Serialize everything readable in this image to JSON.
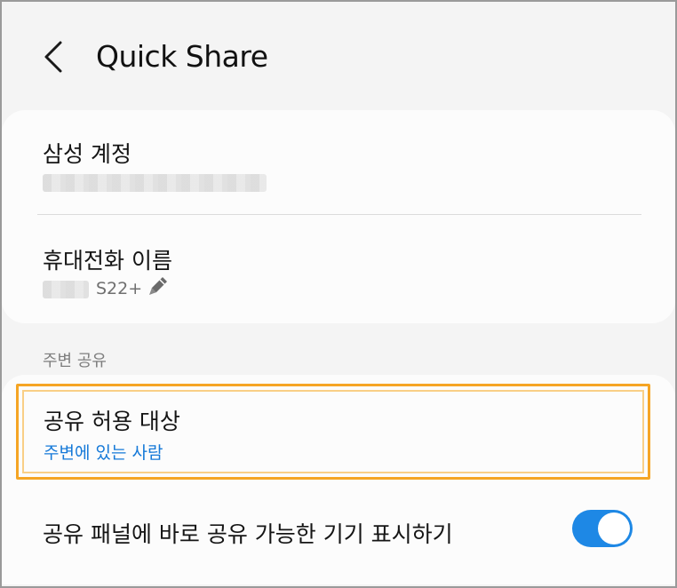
{
  "header": {
    "title": "Quick Share",
    "back_icon": "chevron-left-icon"
  },
  "account": {
    "label": "삼성 계정"
  },
  "device": {
    "label": "휴대전화 이름",
    "model": "S22+",
    "edit_icon": "pencil-icon"
  },
  "nearby": {
    "section_label": "주변 공유",
    "share_with_label": "공유 허용 대상",
    "share_with_value": "주변에 있는 사람",
    "show_devices_label": "공유 패널에 바로 공유 가능한 기기 표시하기",
    "show_devices_on": true
  },
  "colors": {
    "accent": "#1579d8",
    "toggle_on": "#1e88e5",
    "highlight_border": "#f5a524",
    "background": "#f4f4f4",
    "card": "#fcfcfc"
  }
}
